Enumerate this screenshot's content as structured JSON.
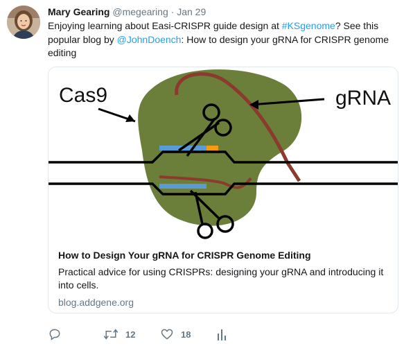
{
  "tweet": {
    "author_name": "Mary Gearing",
    "author_handle": "@megearing",
    "separator": "·",
    "time": "Jan 29",
    "text_1": "Enjoying learning about Easi-CRISPR guide design at ",
    "hashtag": "#KSgenome",
    "text_2": "? See this popular blog by ",
    "mention": "@JohnDoench",
    "text_3": ": How to design your gRNA for CRISPR genome editing"
  },
  "card": {
    "image_labels": {
      "left": "Cas9",
      "right": "gRNA"
    },
    "title": "How to Design Your gRNA for CRISPR Genome Editing",
    "description": "Practical advice for using CRISPRs: designing your gRNA and introducing it into cells.",
    "domain": "blog.addgene.org"
  },
  "actions": {
    "retweet_count": "12",
    "like_count": "18"
  },
  "colors": {
    "link": "#1da1f2",
    "muted": "#657786",
    "cas9_green": "#6b7f3a",
    "grna_red": "#8b3a2e",
    "strand_blue": "#5b9bd5",
    "pam_orange": "#f39c12"
  }
}
